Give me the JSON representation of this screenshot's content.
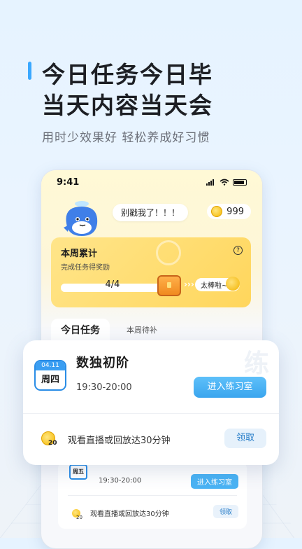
{
  "headline": {
    "line1": "今日任务今日毕",
    "line2": "当天内容当天会",
    "subtitle": "用时少效果好 轻松养成好习惯"
  },
  "status_bar": {
    "time": "9:41"
  },
  "mascot_bubble": "别戳我了！！！",
  "coins": {
    "count": "999"
  },
  "weekly": {
    "title": "本周累计",
    "subtitle": "完成任务得奖励",
    "progress_text": "4/4",
    "progress_fraction": 1.0,
    "reward_text": "太棒啦~"
  },
  "tabs": {
    "today": "今日任务",
    "makeup": "本周待补"
  },
  "main_card": {
    "date": "04.11",
    "weekday": "周四",
    "watermark": "练",
    "course_title": "数独初阶",
    "time": "19:30-20:00",
    "enter_button": "进入练习室",
    "task_coin_num": "20",
    "task_text": "观看直播或回放达30分钟",
    "claim_button": "领取"
  },
  "mini_card": {
    "weekday": "周五",
    "time": "19:30-20:00",
    "enter_button": "进入练习室",
    "task_coin_num": "20",
    "task_text": "观看直播或回放达30分钟",
    "claim_button": "领取"
  },
  "colors": {
    "accent": "#3aa8ff",
    "button_blue": "#3aa5ee",
    "weekly_yellow": "#ffd65c"
  }
}
